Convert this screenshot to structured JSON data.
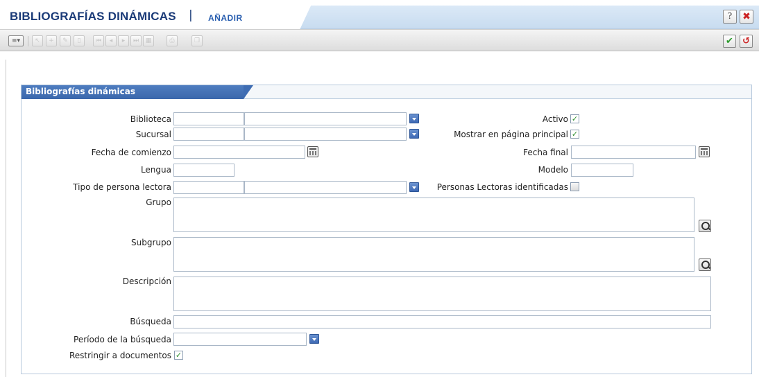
{
  "header": {
    "title": "BIBLIOGRAFÍAS DINÁMICAS",
    "separator": "|",
    "mode": "AÑADIR",
    "help_label": "?",
    "close_label": "✖"
  },
  "toolbar": {
    "icons": [
      "menu-icon",
      "select-icon",
      "add-icon",
      "edit-icon",
      "delete-icon",
      "first-icon",
      "prev-icon",
      "next-icon",
      "last-icon",
      "grid-icon",
      "print-icon",
      "copy-icon"
    ],
    "ok_label": "✔",
    "undo_label": "↺"
  },
  "panel": {
    "tab_label": "Bibliografías dinámicas"
  },
  "form": {
    "biblioteca": {
      "label": "Biblioteca",
      "code": "",
      "value": ""
    },
    "sucursal": {
      "label": "Sucursal",
      "code": "",
      "value": ""
    },
    "fecha_comienzo": {
      "label": "Fecha de comienzo",
      "value": ""
    },
    "lengua": {
      "label": "Lengua",
      "value": ""
    },
    "tipo_persona": {
      "label": "Tipo de persona lectora",
      "code": "",
      "value": ""
    },
    "grupo": {
      "label": "Grupo",
      "value": ""
    },
    "subgrupo": {
      "label": "Subgrupo",
      "value": ""
    },
    "descripcion": {
      "label": "Descripción",
      "value": ""
    },
    "busqueda": {
      "label": "Búsqueda",
      "value": ""
    },
    "periodo_busqueda": {
      "label": "Período de la búsqueda",
      "value": ""
    },
    "restringir": {
      "label": "Restringir a documentos",
      "checked": true
    },
    "activo": {
      "label": "Activo",
      "checked": true
    },
    "mostrar": {
      "label": "Mostrar en página principal",
      "checked": true
    },
    "fecha_final": {
      "label": "Fecha final",
      "value": ""
    },
    "modelo": {
      "label": "Modelo",
      "value": ""
    },
    "personas_identificadas": {
      "label": "Personas Lectoras identificadas",
      "checked": false
    }
  },
  "check_glyph": "✓"
}
